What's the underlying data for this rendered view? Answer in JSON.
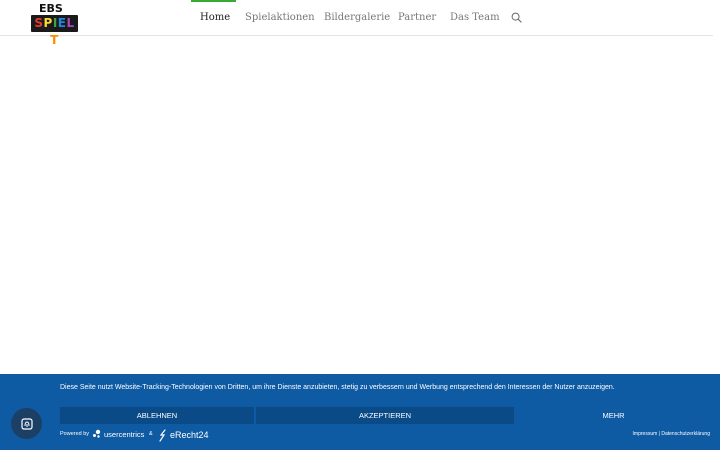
{
  "logo": {
    "top": "EBS",
    "bottom": [
      "S",
      "P",
      "I",
      "E",
      "L",
      "T"
    ]
  },
  "nav": {
    "items": [
      {
        "label": "Home",
        "active": true
      },
      {
        "label": "Spielaktionen"
      },
      {
        "label": "Bildergalerie"
      },
      {
        "label": "Partner"
      },
      {
        "label": "Das Team"
      }
    ],
    "accent": "#3aaa35"
  },
  "cookie": {
    "text": "Diese Seite nutzt Website-Tracking-Technologien von Dritten, um ihre Dienste anzubieten, stetig zu verbessern und Werbung entsprechend den Interessen der Nutzer anzuzeigen.",
    "decline_label": "Ablehnen",
    "accept_label": "Akzeptieren",
    "more_label": "Mehr",
    "powered_by": "Powered by",
    "usercentrics": "usercentrics",
    "amp": "&",
    "erecht": "eRecht24",
    "legal": "Impressum | Datenschutzerklärung",
    "background": "#0e5aa3"
  },
  "icons": {
    "search": "search-icon",
    "privacy": "fingerprint-icon"
  }
}
